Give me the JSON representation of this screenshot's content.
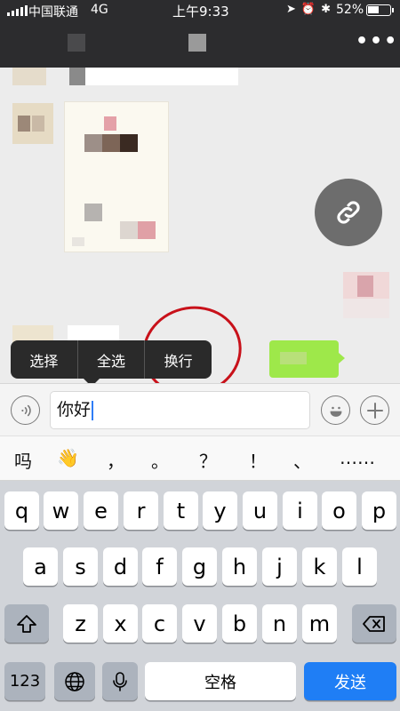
{
  "status_bar": {
    "carrier": "中国联通",
    "network": "4G",
    "time": "上午9:33",
    "battery_percent": "52%",
    "battery_level": 0.52,
    "icons": [
      "location-arrow-icon",
      "alarm-icon",
      "bluetooth-icon"
    ]
  },
  "context_menu": {
    "items": [
      "选择",
      "全选",
      "换行"
    ]
  },
  "input": {
    "value": "你好"
  },
  "candidates": [
    "吗",
    "👋",
    "，",
    "。",
    "？",
    "！",
    "、",
    "……"
  ],
  "keyboard": {
    "row1": [
      "q",
      "w",
      "e",
      "r",
      "t",
      "y",
      "u",
      "i",
      "o",
      "p"
    ],
    "row2": [
      "a",
      "s",
      "d",
      "f",
      "g",
      "h",
      "j",
      "k",
      "l"
    ],
    "row3": [
      "z",
      "x",
      "c",
      "v",
      "b",
      "n",
      "m"
    ],
    "numbers_label": "123",
    "space_label": "空格",
    "send_label": "发送"
  },
  "colors": {
    "nav_bg": "#2c2c2e",
    "sent_bubble": "#9ee84a",
    "send_key": "#1f7ef5",
    "annotation_circle": "#c8111a"
  }
}
